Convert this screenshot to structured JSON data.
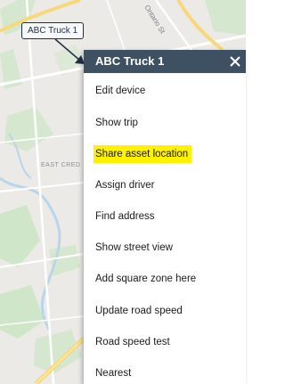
{
  "map": {
    "area_label": "EAST CRED",
    "street_label": "Ontario St"
  },
  "asset_tag": {
    "label": "ABC Truck 1"
  },
  "context_menu": {
    "title": "ABC Truck 1",
    "close_icon": "close-icon",
    "items": [
      {
        "label": "Edit device"
      },
      {
        "label": "Show trip"
      },
      {
        "label": "Share asset location",
        "highlighted": true,
        "highlight_color": "#fff200"
      },
      {
        "label": "Assign driver"
      },
      {
        "label": "Find address"
      },
      {
        "label": "Show street view"
      },
      {
        "label": "Add square zone here"
      },
      {
        "label": "Update road speed"
      },
      {
        "label": "Road speed test"
      },
      {
        "label": "Nearest"
      }
    ],
    "header_color": "#3e5163"
  }
}
